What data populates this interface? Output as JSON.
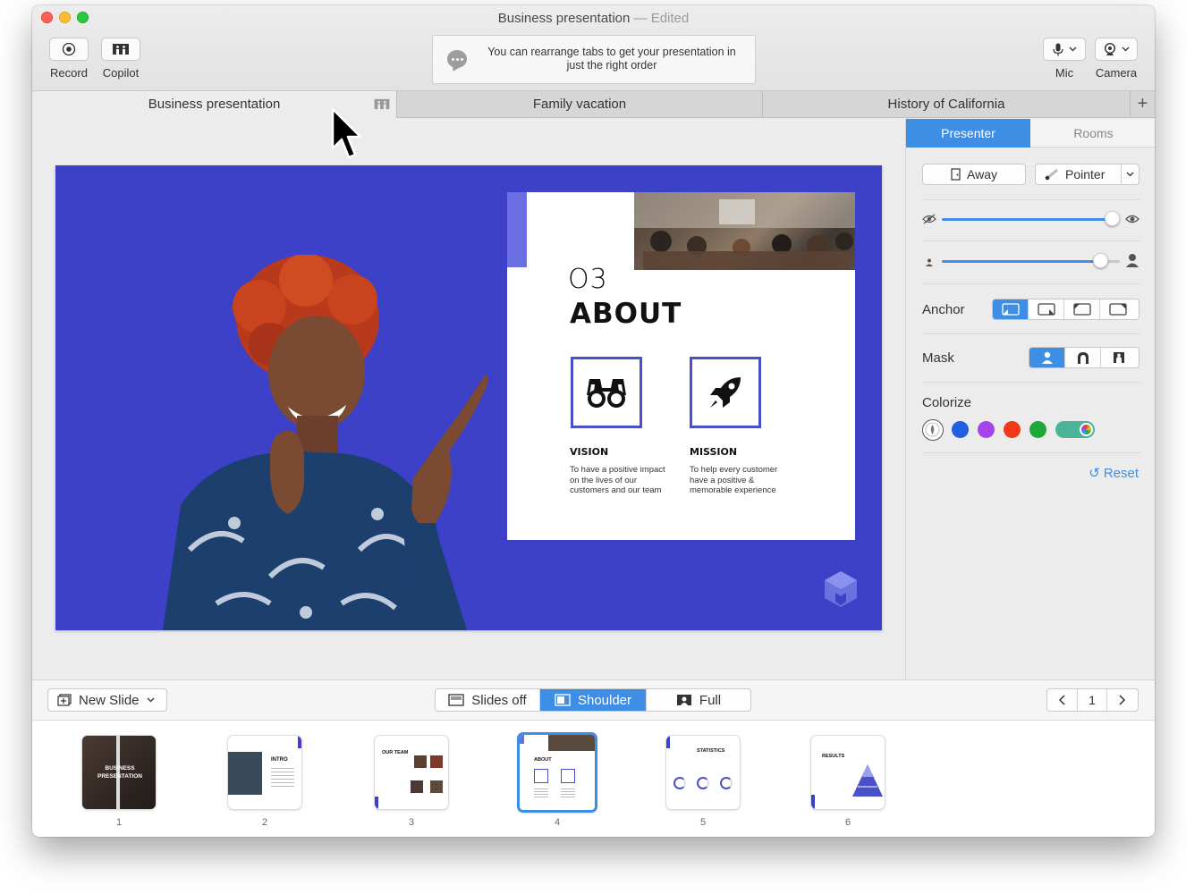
{
  "window": {
    "title": "Business presentation",
    "title_separator": " — ",
    "title_status": "Edited"
  },
  "toolbar": {
    "record_label": "Record",
    "copilot_label": "Copilot",
    "mic_label": "Mic",
    "camera_label": "Camera",
    "notice_text": "You can rearrange tabs to get your presentation in just the right order"
  },
  "tabs": [
    {
      "label": "Business presentation",
      "active": true
    },
    {
      "label": "Family vacation",
      "active": false
    },
    {
      "label": "History of California",
      "active": false
    }
  ],
  "tab_add_label": "+",
  "slide": {
    "number": "O3",
    "title": "ABOUT",
    "vision_title": "VISION",
    "vision_text": "To have a positive impact on the lives of our customers and our team",
    "mission_title": "MISSION",
    "mission_text": "To help every customer have a positive & memorable experience",
    "background_color": "#3c41c8"
  },
  "panel": {
    "tabs": [
      "Presenter",
      "Rooms"
    ],
    "active_tab": "Presenter",
    "away_label": "Away",
    "pointer_label": "Pointer",
    "visibility_slider": 0.98,
    "size_slider": 0.88,
    "anchor_label": "Anchor",
    "anchor_selected": 0,
    "mask_label": "Mask",
    "mask_selected": 0,
    "colorize_label": "Colorize",
    "colors": [
      "#ffffff",
      "#1f5fe0",
      "#a445e8",
      "#f03a1a",
      "#1ea83a"
    ],
    "reset_label": "Reset",
    "accent_color": "#3f8ee5"
  },
  "bottom": {
    "new_slide_label": "New Slide",
    "views": [
      "Slides off",
      "Shoulder",
      "Full"
    ],
    "active_view": "Shoulder",
    "page_number": "1"
  },
  "thumbnails": [
    {
      "num": "1",
      "label": "BUSINESS PRESENTATION"
    },
    {
      "num": "2",
      "label": "INTRO"
    },
    {
      "num": "3",
      "label": "OUR TEAM"
    },
    {
      "num": "4",
      "label": "ABOUT"
    },
    {
      "num": "5",
      "label": "STATISTICS"
    },
    {
      "num": "6",
      "label": "RESULTS"
    }
  ],
  "selected_thumbnail": "4"
}
